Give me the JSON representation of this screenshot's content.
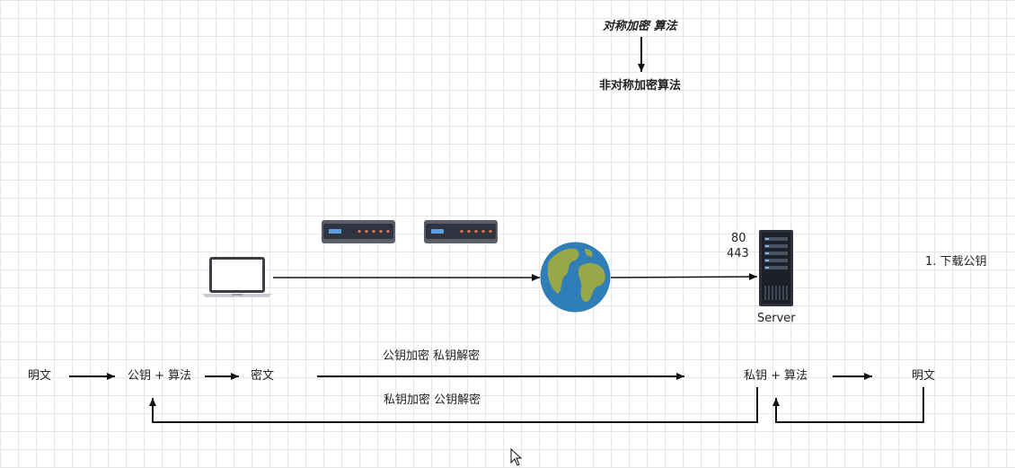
{
  "title": {
    "symmetric": "对称加密 算法",
    "asymmetric": "非对称加密算法"
  },
  "server": {
    "ports": [
      "80",
      "443"
    ],
    "label": "Server"
  },
  "step_note": "1. 下载公钥",
  "flow": {
    "plaintext_left": "明文",
    "public_key_algo": "公钥 + 算法",
    "ciphertext": "密文",
    "private_key_algo": "私钥 + 算法",
    "plaintext_right": "明文",
    "note_top": "公钥加密  私钥解密",
    "note_bottom": "私钥加密 公钥解密"
  }
}
